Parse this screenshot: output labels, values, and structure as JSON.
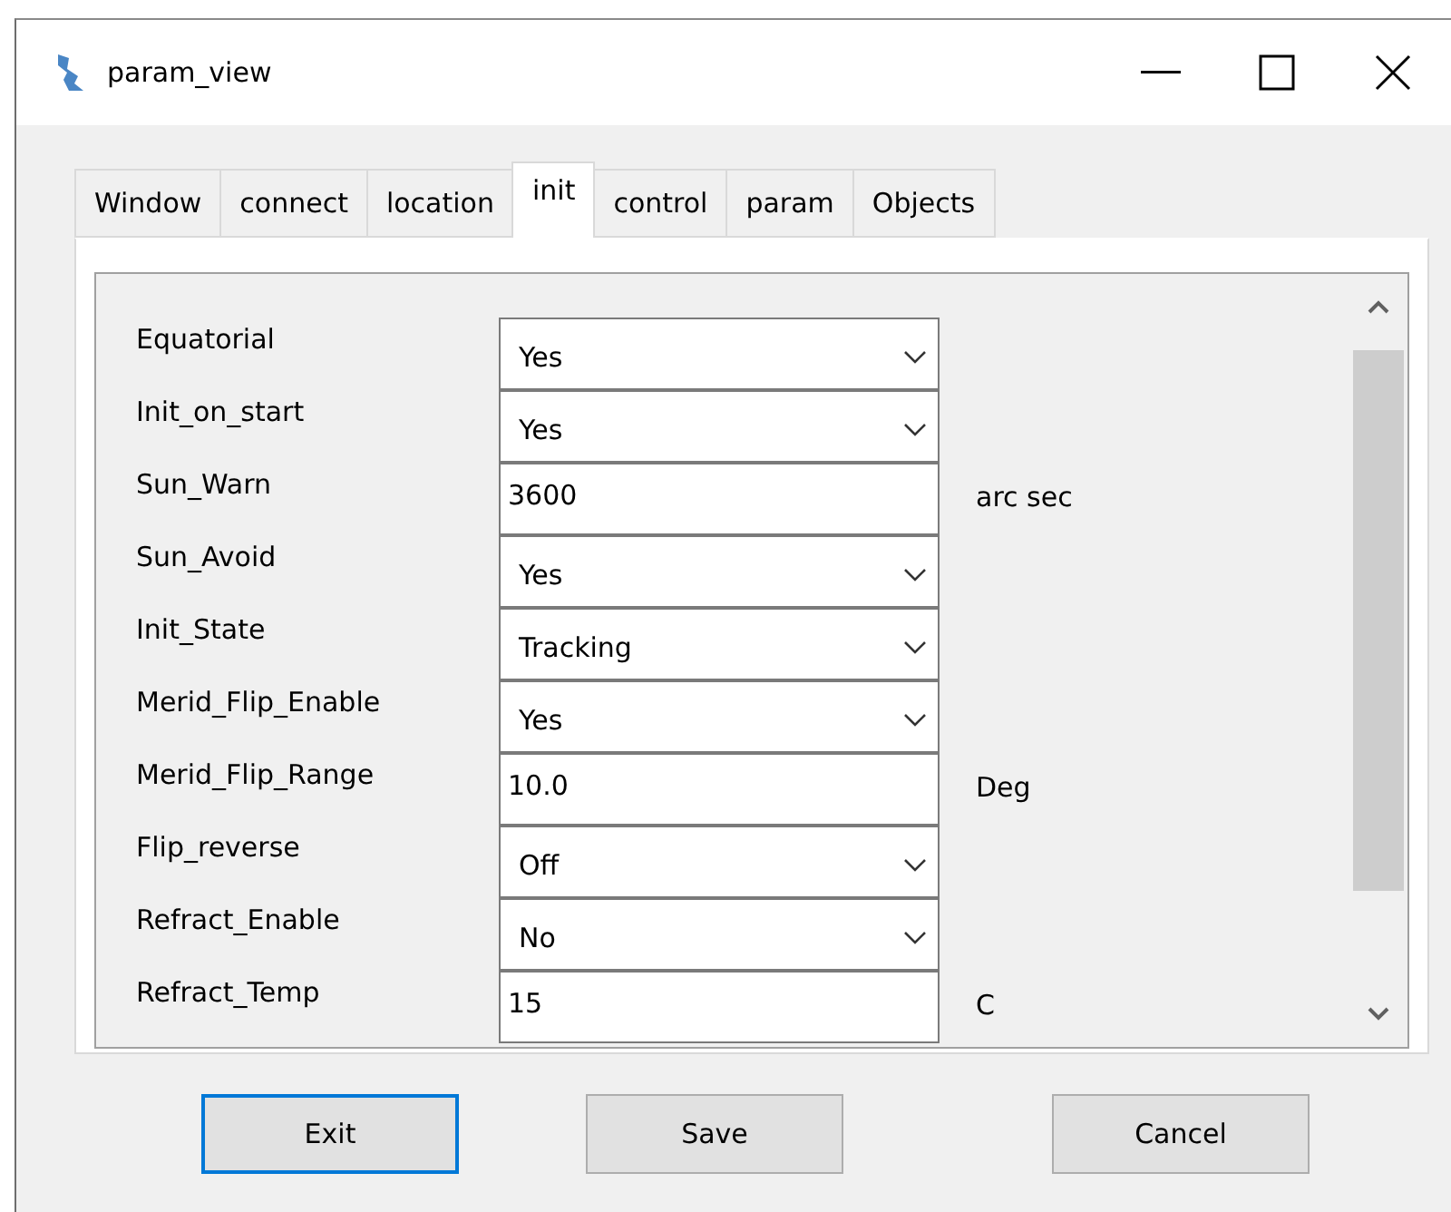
{
  "window": {
    "title": "param_view"
  },
  "tabs": [
    {
      "label": "Window",
      "selected": false
    },
    {
      "label": "connect",
      "selected": false
    },
    {
      "label": "location",
      "selected": false
    },
    {
      "label": "init",
      "selected": true
    },
    {
      "label": "control",
      "selected": false
    },
    {
      "label": "param",
      "selected": false
    },
    {
      "label": "Objects",
      "selected": false
    }
  ],
  "params": [
    {
      "label": "Equatorial",
      "kind": "combo",
      "value": "Yes"
    },
    {
      "label": "Init_on_start",
      "kind": "combo",
      "value": "Yes"
    },
    {
      "label": "Sun_Warn",
      "kind": "text",
      "value": "3600",
      "unit": "arc sec"
    },
    {
      "label": "Sun_Avoid",
      "kind": "combo",
      "value": "Yes"
    },
    {
      "label": "Init_State",
      "kind": "combo",
      "value": "Tracking"
    },
    {
      "label": "Merid_Flip_Enable",
      "kind": "combo",
      "value": "Yes"
    },
    {
      "label": "Merid_Flip_Range",
      "kind": "text",
      "value": "10.0",
      "unit": "Deg"
    },
    {
      "label": "Flip_reverse",
      "kind": "combo",
      "value": "Off"
    },
    {
      "label": "Refract_Enable",
      "kind": "combo",
      "value": "No"
    },
    {
      "label": "Refract_Temp",
      "kind": "text",
      "value": "15",
      "unit": "C"
    }
  ],
  "buttons": [
    {
      "label": "Exit",
      "focused": true
    },
    {
      "label": "Save",
      "focused": false
    },
    {
      "label": "Cancel",
      "focused": false
    }
  ]
}
